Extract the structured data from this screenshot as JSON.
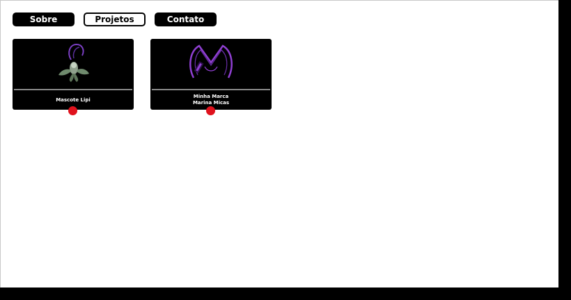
{
  "nav": {
    "items": [
      {
        "label": "Sobre",
        "active": false
      },
      {
        "label": "Projetos",
        "active": true
      },
      {
        "label": "Contato",
        "active": false
      }
    ]
  },
  "projects": [
    {
      "title_line1": "Mascote Lipi",
      "title_line2": "",
      "icon": "lipi-mascot-icon"
    },
    {
      "title_line1": "Minha Marca",
      "title_line2": "Marina Micas",
      "icon": "marina-micas-logo-icon"
    }
  ],
  "colors": {
    "nav_bg": "#000000",
    "card_bg": "#000000",
    "dot": "#e0121d",
    "logo_purple": "#8f3fd1",
    "mascot_green": "#6f8a6d"
  }
}
